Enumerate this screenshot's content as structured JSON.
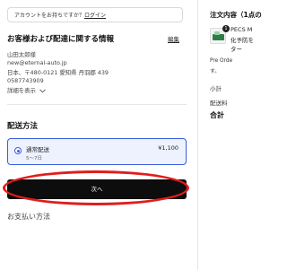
{
  "login": {
    "prompt": "アカウントをお持ちですか？",
    "link": "ログイン"
  },
  "customer": {
    "title": "お客様および配達に関する情報",
    "edit": "編集",
    "lines": [
      "山田太郎様",
      "new@eternal-auto.jp",
      "日本、〒480-0121 愛知県 丹羽郡 439",
      "0587743909"
    ],
    "details": "詳細を表示"
  },
  "shipping": {
    "title": "配送方法",
    "option_name": "通常配送",
    "option_days": "5〜7日",
    "option_price": "¥1,100"
  },
  "next_button": "次へ",
  "payment_title": "お支払い方法",
  "summary": {
    "title": "注文内容（1点の",
    "quantity": "1",
    "product_lines": [
      "PECS M",
      "化予防を",
      "ター"
    ],
    "preorder_lines": [
      "Pre Orde",
      "す。"
    ],
    "subtotal": "小計",
    "shipping": "配送料",
    "total": "合計"
  }
}
